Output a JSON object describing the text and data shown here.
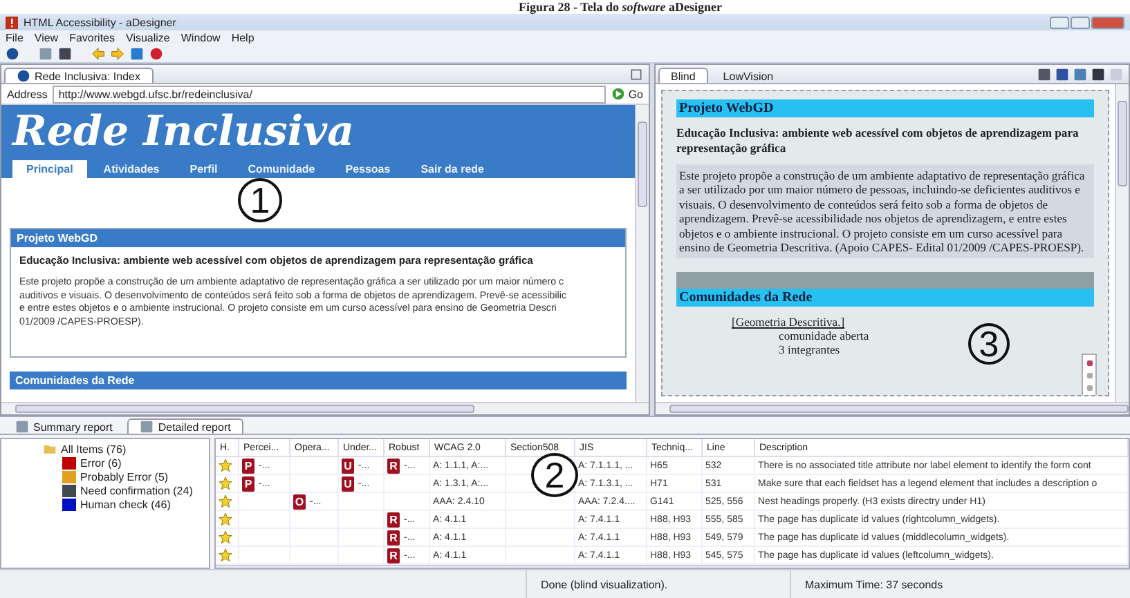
{
  "caption": "Figura 28 - Tela do *software* aDesigner",
  "window": {
    "title": "HTML Accessibility - aDesigner"
  },
  "menu": [
    "File",
    "View",
    "Favorites",
    "Visualize",
    "Window",
    "Help"
  ],
  "browser": {
    "tab": "Rede Inclusiva: Index",
    "address_label": "Address",
    "address": "http://www.webgd.ufsc.br/redeinclusiva/",
    "go": "Go",
    "site_title": "Rede Inclusiva",
    "nav": [
      {
        "label": "Principal",
        "selected": true
      },
      {
        "label": "Atividades",
        "selected": false
      },
      {
        "label": "Perfil",
        "selected": false
      },
      {
        "label": "Comunidade",
        "selected": false
      },
      {
        "label": "Pessoas",
        "selected": false
      },
      {
        "label": "Sair da rede",
        "selected": false
      }
    ],
    "section_title": "Projeto WebGD",
    "heading": "Educação Inclusiva: ambiente web acessível com objetos de aprendizagem para representação gráfica",
    "paragraph_lines": [
      "Este projeto propõe a construção de um ambiente adaptativo de representação gráfica a ser utilizado por um maior número c",
      "auditivos e visuais. O desenvolvimento de conteúdos será feito sob a forma de objetos de aprendizagem. Prevê-se acessibilic",
      "e entre estes objetos e o ambiente instrucional. O projeto consiste em um curso acessível para ensino de Geometria Descri",
      "01/2009 /CAPES-PROESP)."
    ],
    "next_section": "Comunidades da Rede"
  },
  "viewer": {
    "tabs": [
      {
        "label": "Blind",
        "selected": true
      },
      {
        "label": "LowVision",
        "selected": false
      }
    ],
    "section_title": "Projeto WebGD",
    "heading": "Educação Inclusiva: ambiente web acessível com objetos de aprendizagem para representação gráfica",
    "paragraph": "Este projeto propõe a construção de um ambiente adaptativo de representação gráfica a ser utilizado por um maior número de pessoas, incluindo-se deficientes auditivos e visuais. O desenvolvimento de conteúdos será feito sob a forma de objetos de aprendizagem. Prevê-se acessibilidade nos objetos de aprendizagem, e entre estes objetos e o ambiente instrucional. O projeto consiste em um curso acessível para ensino de Geometria Descritiva. (Apoio CAPES- Edital 01/2009 /CAPES-PROESP).",
    "next_section": "Comunidades da Rede",
    "link": "[Geometria Descritiva.]",
    "lines": [
      "comunidade aberta",
      "3 integrantes"
    ]
  },
  "report": {
    "tabs": [
      {
        "label": "Summary report",
        "selected": false
      },
      {
        "label": "Detailed report",
        "selected": true
      }
    ],
    "tree": {
      "label": "All Items (76)",
      "children": [
        {
          "label": "Error (6)",
          "color": "#c00000"
        },
        {
          "label": "Probably Error (5)",
          "color": "#e0a020"
        },
        {
          "label": "Need confirmation (24)",
          "color": "#404850"
        },
        {
          "label": "Human check (46)",
          "color": "#0010c0"
        }
      ]
    },
    "table": {
      "columns": [
        "H.",
        "Percei...",
        "Opera...",
        "Under...",
        "Robust",
        "WCAG 2.0",
        "Section508",
        "JIS",
        "Techniq...",
        "Line",
        "Description"
      ],
      "rows": [
        {
          "perceivable": {
            "badge": "P",
            "text": "-..."
          },
          "understandable": {
            "badge": "U",
            "text": "-..."
          },
          "robust": {
            "badge": "R",
            "text": "-..."
          },
          "wcag": "A: 1.1.1, A:...",
          "jis": "A: 7.1.1.1, ...",
          "technique": "H65",
          "line": "532",
          "description": "There is no associated title attribute nor label element to identify the form cont"
        },
        {
          "perceivable": {
            "badge": "P",
            "text": "-..."
          },
          "understandable": {
            "badge": "U",
            "text": "-..."
          },
          "wcag": "A: 1.3.1, A:...",
          "jis": "A: 7.1.3.1, ...",
          "technique": "H71",
          "line": "531",
          "description": "Make sure that each fieldset has a legend element that includes a description o"
        },
        {
          "operable": {
            "badge": "O",
            "text": "-..."
          },
          "wcag": "AAA: 2.4.10",
          "jis": "AAA: 7.2.4....",
          "technique": "G141",
          "line": "525, 556",
          "description": "Nest headings properly.  (H3 exists directry under H1)"
        },
        {
          "robust": {
            "badge": "R",
            "text": "-..."
          },
          "wcag": "A: 4.1.1",
          "jis": "A: 7.4.1.1",
          "technique": "H88, H93",
          "line": "555, 585",
          "description": "The page has duplicate id values (rightcolumn_widgets)."
        },
        {
          "robust": {
            "badge": "R",
            "text": "-..."
          },
          "wcag": "A: 4.1.1",
          "jis": "A: 7.4.1.1",
          "technique": "H88, H93",
          "line": "549, 579",
          "description": "The page has duplicate id values (middlecolumn_widgets)."
        },
        {
          "robust": {
            "badge": "R",
            "text": "-..."
          },
          "wcag": "A: 4.1.1",
          "jis": "A: 7.4.1.1",
          "technique": "H88, H93",
          "line": "545, 575",
          "description": "The page has duplicate id values (leftcolumn_widgets)."
        }
      ]
    }
  },
  "status_bar": [
    "Done (blind visualization).",
    "Maximum Time: 37 seconds"
  ],
  "callouts": [
    "1",
    "2",
    "3"
  ]
}
